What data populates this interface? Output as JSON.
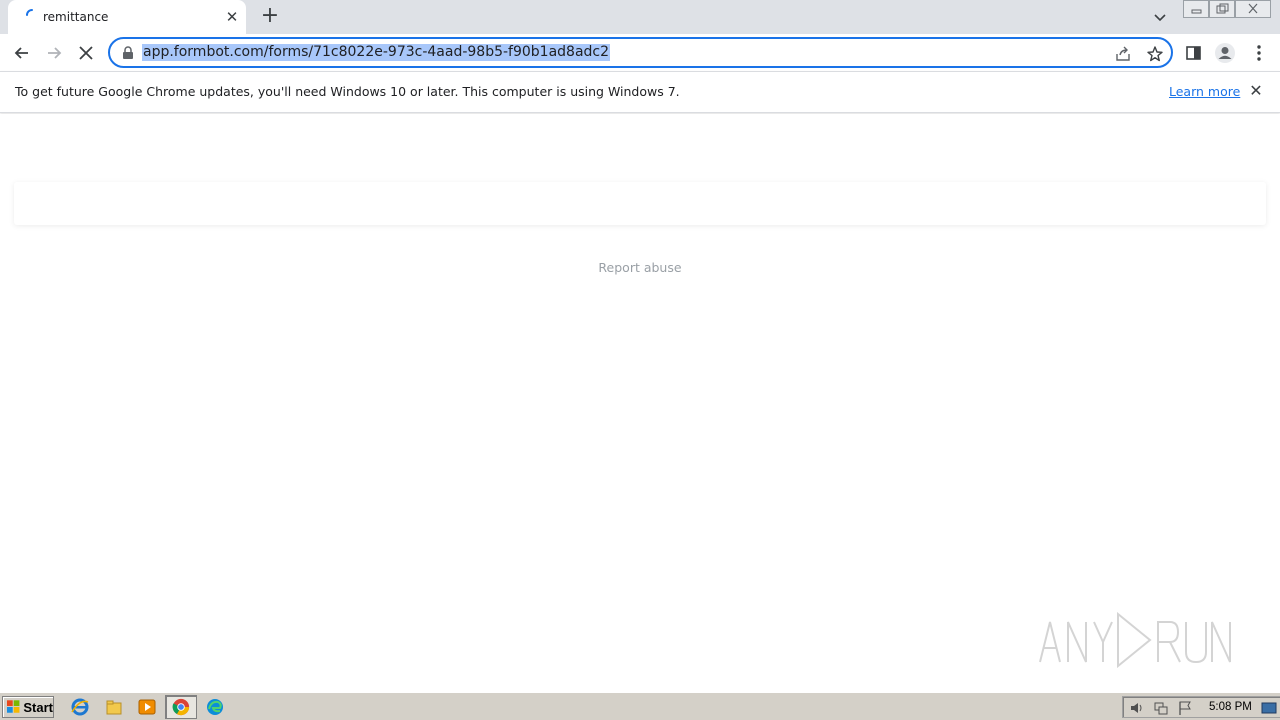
{
  "browser": {
    "tab": {
      "title": "remittance"
    },
    "address_bar": {
      "url": "app.formbot.com/forms/71c8022e-973c-4aad-98b5-f90b1ad8adc2"
    }
  },
  "infobar": {
    "message": "To get future Google Chrome updates, you'll need Windows 10 or later. This computer is using Windows 7.",
    "link": "Learn more"
  },
  "page": {
    "report_abuse": "Report abuse",
    "watermark": "ANY RUN"
  },
  "taskbar": {
    "start_label": "Start",
    "clock": "5:08 PM"
  },
  "colors": {
    "accent": "#1a73e8",
    "url_highlight": "#a8c7fa",
    "taskbar": "#d4d0c8"
  }
}
